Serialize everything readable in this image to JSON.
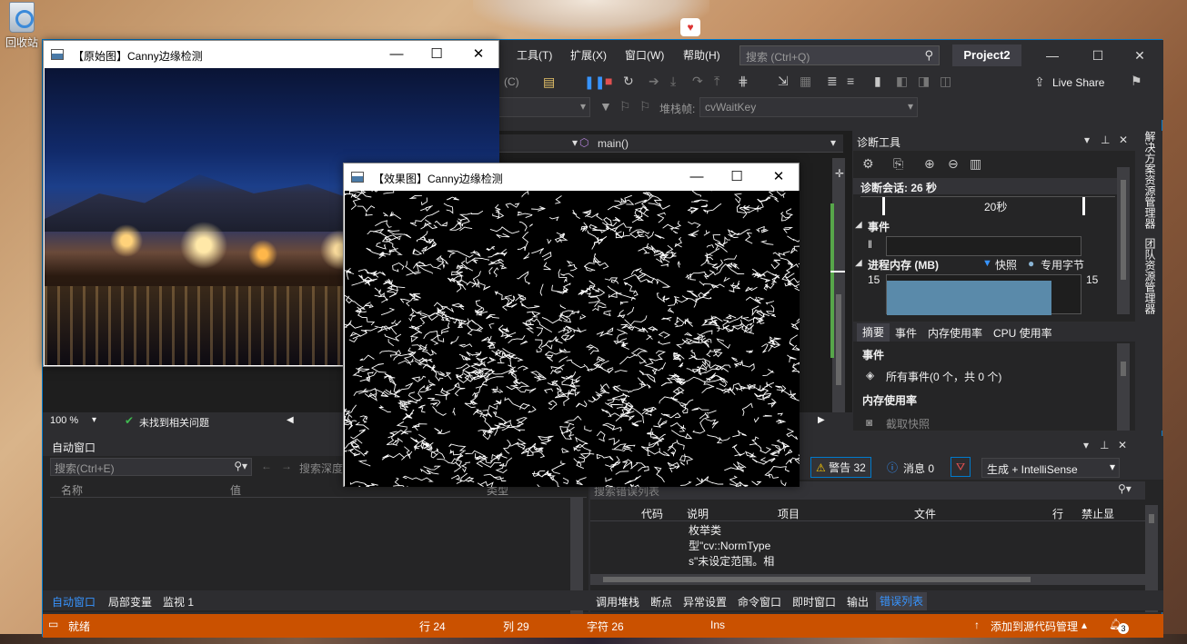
{
  "desktop": {
    "recycle_bin_label": "回收站"
  },
  "vs": {
    "menu": [
      "工具(T)",
      "扩展(X)",
      "窗口(W)",
      "帮助(H)"
    ],
    "search_placeholder": "搜索 (Ctrl+Q)",
    "project_name": "Project2",
    "live_share": "Live Share",
    "toolbar": {
      "stack_frame_label": "堆栈帧:",
      "stack_frame_value": "cvWaitKey",
      "partial_dropdown": "(C)"
    },
    "editor": {
      "function_dropdown": "main()"
    },
    "zoom": "100 %",
    "no_issues": "未找到相关问题",
    "side_rail": [
      "解决方案资源管理器",
      "团队资源管理器"
    ]
  },
  "diagnostics": {
    "title": "诊断工具",
    "session": "诊断会话: 26 秒",
    "timeline_tick": "20秒",
    "events_header": "事件",
    "memory_header": "进程内存 (MB)",
    "legend_snapshot": "快照",
    "legend_private": "专用字节",
    "mem_left": "15",
    "mem_right": "15",
    "mem_fill_fraction": 0.85,
    "tabs": [
      "摘要",
      "事件",
      "内存使用率",
      "CPU 使用率"
    ],
    "events_section": "事件",
    "all_events": "所有事件(0 个，共 0 个)",
    "mem_usage_section": "内存使用率",
    "take_snapshot": "截取快照"
  },
  "autos": {
    "title": "自动窗口",
    "search_placeholder": "搜索(Ctrl+E)",
    "depth_placeholder": "搜索深度",
    "col_name": "名称",
    "col_value": "值",
    "col_type": "类型",
    "tabs": [
      "自动窗口",
      "局部变量",
      "监视 1"
    ]
  },
  "errors": {
    "warnings": "警告 32",
    "messages": "消息 0",
    "build_filter": "生成 + IntelliSense",
    "search_placeholder": "搜索错误列表",
    "cols": [
      "代码",
      "说明",
      "项目",
      "文件",
      "行",
      "禁止显"
    ],
    "row_text": [
      "枚举类",
      "型\"cv::NormType",
      "s\"未设定范围。相"
    ],
    "tabs": [
      "调用堆栈",
      "断点",
      "异常设置",
      "命令窗口",
      "即时窗口",
      "输出",
      "错误列表"
    ]
  },
  "statusbar": {
    "ready": "就绪",
    "line": "行 24",
    "col": "列 29",
    "char": "字符 26",
    "ins": "Ins",
    "source_control": "添加到源代码管理",
    "notif_count": "3"
  },
  "cv_original": {
    "title": "【原始图】Canny边缘检测"
  },
  "cv_edges": {
    "title": "【效果图】Canny边缘检测"
  },
  "colors": {
    "vs_bg": "#2d2d30",
    "accent": "#007acc",
    "status_bar": "#ca5100"
  }
}
